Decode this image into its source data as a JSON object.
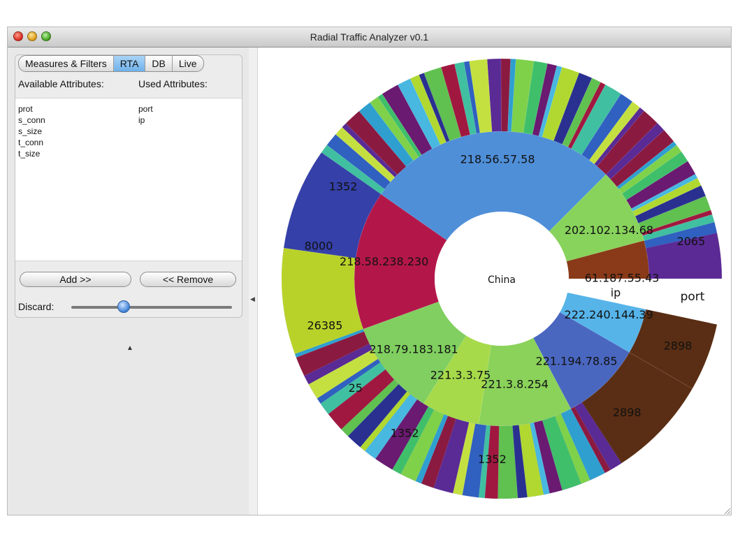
{
  "window": {
    "title": "Radial Traffic Analyzer v0.1",
    "controls": [
      "close",
      "minimize",
      "zoom"
    ]
  },
  "tabs": [
    {
      "label": "Measures & Filters",
      "active": false
    },
    {
      "label": "RTA",
      "active": true
    },
    {
      "label": "DB",
      "active": false
    },
    {
      "label": "Live",
      "active": false
    }
  ],
  "attributes": {
    "available_header": "Available Attributes:",
    "used_header": "Used Attributes:",
    "available": [
      "prot",
      "s_conn",
      "s_size",
      "t_conn",
      "t_size"
    ],
    "used": [
      "port",
      "ip"
    ]
  },
  "buttons": {
    "add": "Add >>",
    "remove": "<< Remove"
  },
  "discard": {
    "label": "Discard:",
    "level": 0.35
  },
  "chart": {
    "center_label": "China",
    "ring_labels": {
      "inner": "ip",
      "outer": "port"
    }
  },
  "chart_data": {
    "type": "sunburst",
    "center": "China",
    "rings": [
      "ip",
      "port"
    ],
    "ip_segments": [
      {
        "label": "222.240.144.39",
        "color": "#56b4e9"
      },
      {
        "label": "221.194.78.85",
        "color": "#4a67c0"
      },
      {
        "label": "221.3.8.254",
        "color": "#8ad25a"
      },
      {
        "label": "221.3.3.75",
        "color": "#a6da4a"
      },
      {
        "label": "218.79.183.181",
        "color": "#80cf60"
      },
      {
        "label": "218.58.238.230",
        "color": "#b3174a"
      },
      {
        "label": "218.56.57.58",
        "color": "#4f8fd8"
      },
      {
        "label": "202.102.134.68",
        "color": "#88d35c"
      },
      {
        "label": "61.187.55.43",
        "color": "#8a3a18"
      }
    ],
    "port_segments": [
      {
        "label": "2898",
        "color": "#5a2e14"
      },
      {
        "label": "2898",
        "color": "#5a2e14"
      },
      {
        "label": "1352",
        "color": "#3540a8"
      },
      {
        "label": "1352",
        "color": "#3540a8"
      },
      {
        "label": "25",
        "color": "#2a3795"
      },
      {
        "label": "26385",
        "color": "#7a1830"
      },
      {
        "label": "8000",
        "color": "#b9d22a"
      },
      {
        "label": "1352",
        "color": "#2f3fa0"
      },
      {
        "label": "2065",
        "color": "#5b2a95"
      }
    ]
  }
}
